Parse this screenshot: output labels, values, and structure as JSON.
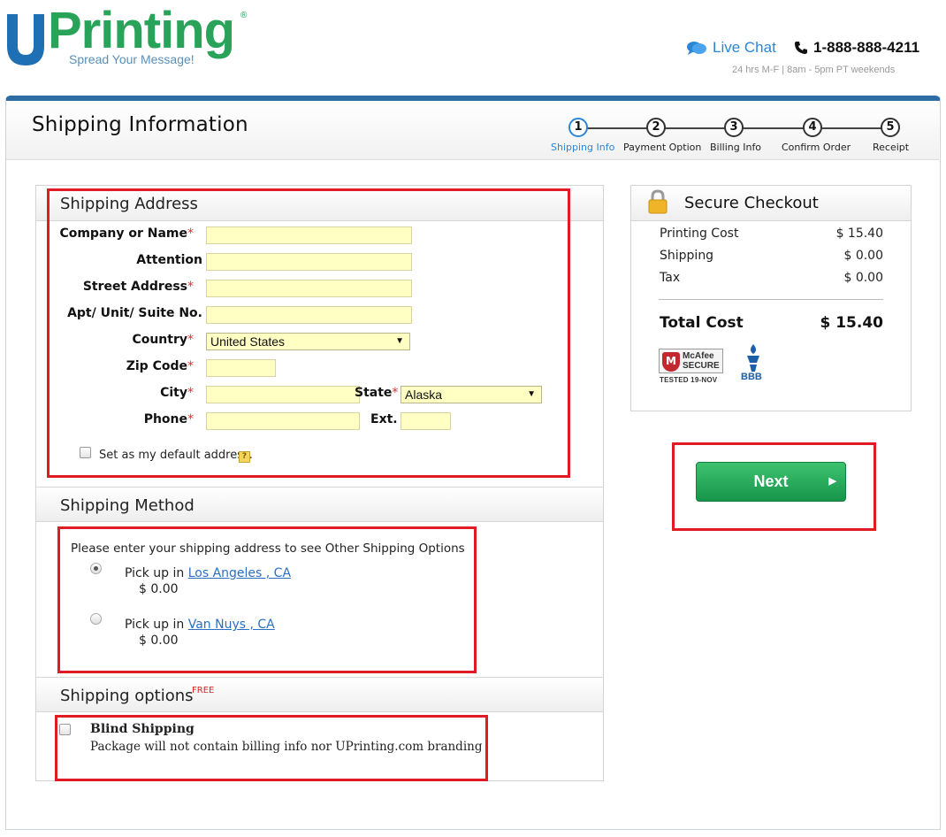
{
  "brand": {
    "logo_text": "Printing",
    "tagline": "Spread Your Message!",
    "brand_green": "#2aa35a",
    "brand_blue": "#1e6fb3"
  },
  "header": {
    "live_chat": "Live Chat",
    "phone": "1-888-888-4211",
    "hours": "24 hrs M-F | 8am - 5pm PT weekends"
  },
  "page": {
    "title": "Shipping Information"
  },
  "steps": [
    {
      "num": "1",
      "label": "Shipping Info",
      "active": true
    },
    {
      "num": "2",
      "label": "Payment Option",
      "active": false
    },
    {
      "num": "3",
      "label": "Billing Info",
      "active": false
    },
    {
      "num": "4",
      "label": "Confirm Order",
      "active": false
    },
    {
      "num": "5",
      "label": "Receipt",
      "active": false
    }
  ],
  "shipping_address": {
    "title": "Shipping Address",
    "company_label": "Company or Name",
    "attention_label": "Attention",
    "street_label": "Street Address",
    "apt_label": "Apt/ Unit/ Suite No.",
    "country_label": "Country",
    "country_value": "United States",
    "zip_label": "Zip Code",
    "city_label": "City",
    "state_label": "State",
    "state_value": "Alaska",
    "phone_label": "Phone",
    "ext_label": "Ext.",
    "required_mark": "*",
    "default_label": "Set as my default address.",
    "help": "?"
  },
  "shipping_method": {
    "title": "Shipping Method",
    "note": "Please enter your shipping address to see Other Shipping Options",
    "options": [
      {
        "prefix": "Pick up in",
        "location": "Los Angeles , CA",
        "price": "$ 0.00",
        "selected": true
      },
      {
        "prefix": "Pick up in",
        "location": "Van Nuys , CA",
        "price": "$ 0.00",
        "selected": false
      }
    ]
  },
  "shipping_options": {
    "title": "Shipping options",
    "free_tag": "FREE",
    "blind_title": "Blind Shipping",
    "blind_desc": "Package will not contain billing info nor UPrinting.com branding"
  },
  "summary": {
    "title": "Secure Checkout",
    "rows": [
      {
        "label": "Printing Cost",
        "value": "$ 15.40"
      },
      {
        "label": "Shipping",
        "value": "$ 0.00"
      },
      {
        "label": "Tax",
        "value": "$ 0.00"
      }
    ],
    "total_label": "Total Cost",
    "total_value": "$ 15.40",
    "mcafee_line1": "McAfee",
    "mcafee_line2": "SECURE",
    "mcafee_sub": "TESTED 19-NOV",
    "bbb": "BBB"
  },
  "next_button": {
    "label": "Next",
    "arrow": "▶"
  },
  "colors": {
    "highlight": "#e01b24",
    "button_green": "#22a755",
    "link_blue": "#2b6fc2",
    "input_yellow": "#ffffc4"
  }
}
